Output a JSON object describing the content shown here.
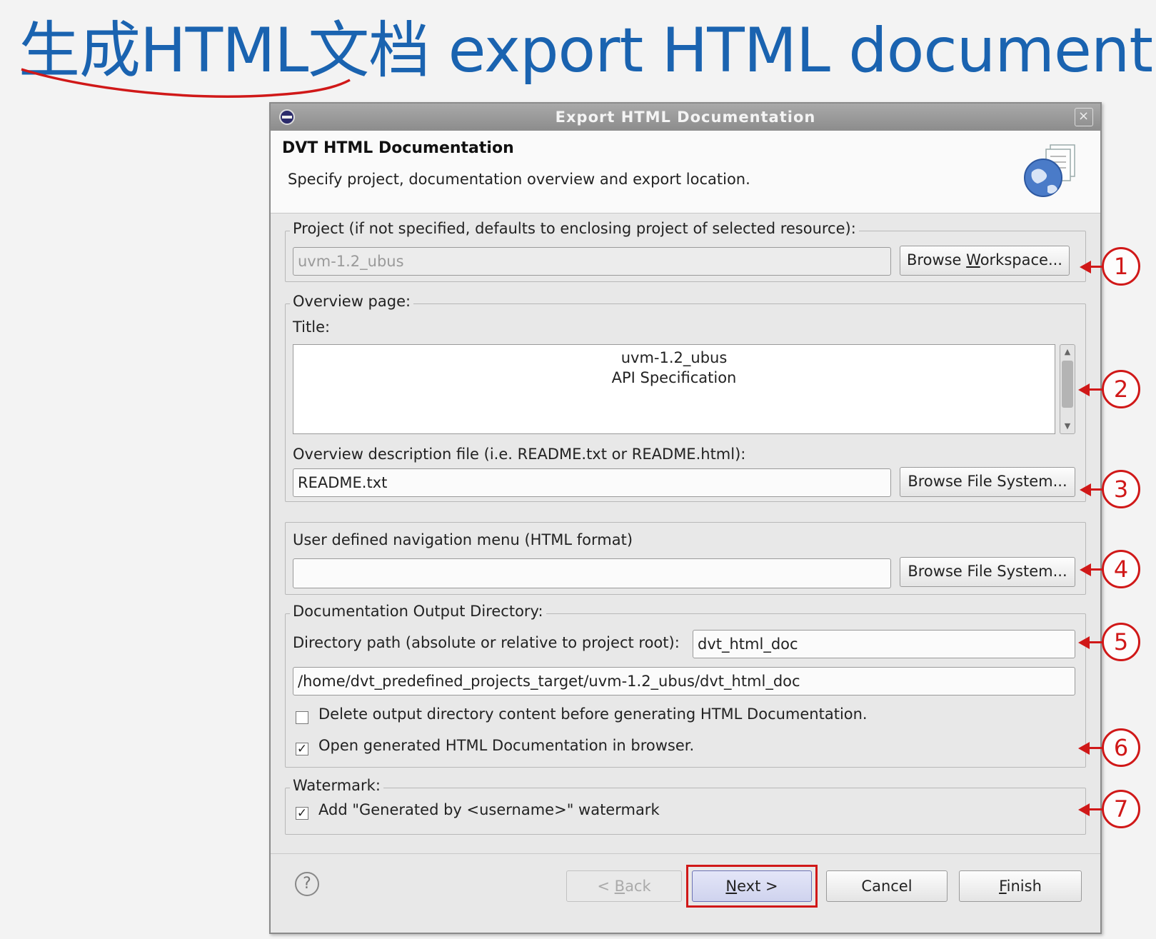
{
  "slide": {
    "heading": "生成HTML文档 export HTML document"
  },
  "dialog": {
    "window_title": "Export HTML Documentation",
    "header_title": "DVT HTML Documentation",
    "header_description": "Specify project, documentation overview and export location.",
    "project_group": {
      "legend": "Project (if not specified, defaults to enclosing project of selected resource):",
      "value": "uvm-1.2_ubus",
      "browse_label": "Browse Workspace..."
    },
    "overview_group": {
      "legend": "Overview page:",
      "title_label": "Title:",
      "title_line1": "uvm-1.2_ubus",
      "title_line2": "API Specification",
      "desc_file_label": "Overview description file (i.e. README.txt or README.html):",
      "desc_file_value": "README.txt",
      "browse_label": "Browse File System..."
    },
    "nav_group": {
      "label": "User defined navigation menu (HTML format)",
      "value": "",
      "browse_label": "Browse File System..."
    },
    "output_group": {
      "legend": "Documentation Output Directory:",
      "dir_label": "Directory path (absolute or relative to project root):",
      "dir_value": "dvt_html_doc",
      "full_path": "/home/dvt_predefined_projects_target/uvm-1.2_ubus/dvt_html_doc",
      "delete_label": "Delete output directory content before generating HTML Documentation.",
      "delete_checked": false,
      "open_label": "Open generated HTML Documentation in browser.",
      "open_checked": true
    },
    "watermark_group": {
      "legend": "Watermark:",
      "label": "Add \"Generated by <username>\" watermark",
      "checked": true
    },
    "buttons": {
      "help": "?",
      "back": "< Back",
      "next": "Next >",
      "cancel": "Cancel",
      "finish": "Finish"
    }
  },
  "callouts": [
    "1",
    "2",
    "3",
    "4",
    "5",
    "6",
    "7"
  ],
  "colors": {
    "heading": "#1a63b0",
    "annotation_red": "#d01818"
  },
  "icons": {
    "app": "eclipse-icon",
    "close": "close-icon",
    "banner": "globe-document-icon",
    "help": "help-icon",
    "check": "checkmark-icon"
  }
}
